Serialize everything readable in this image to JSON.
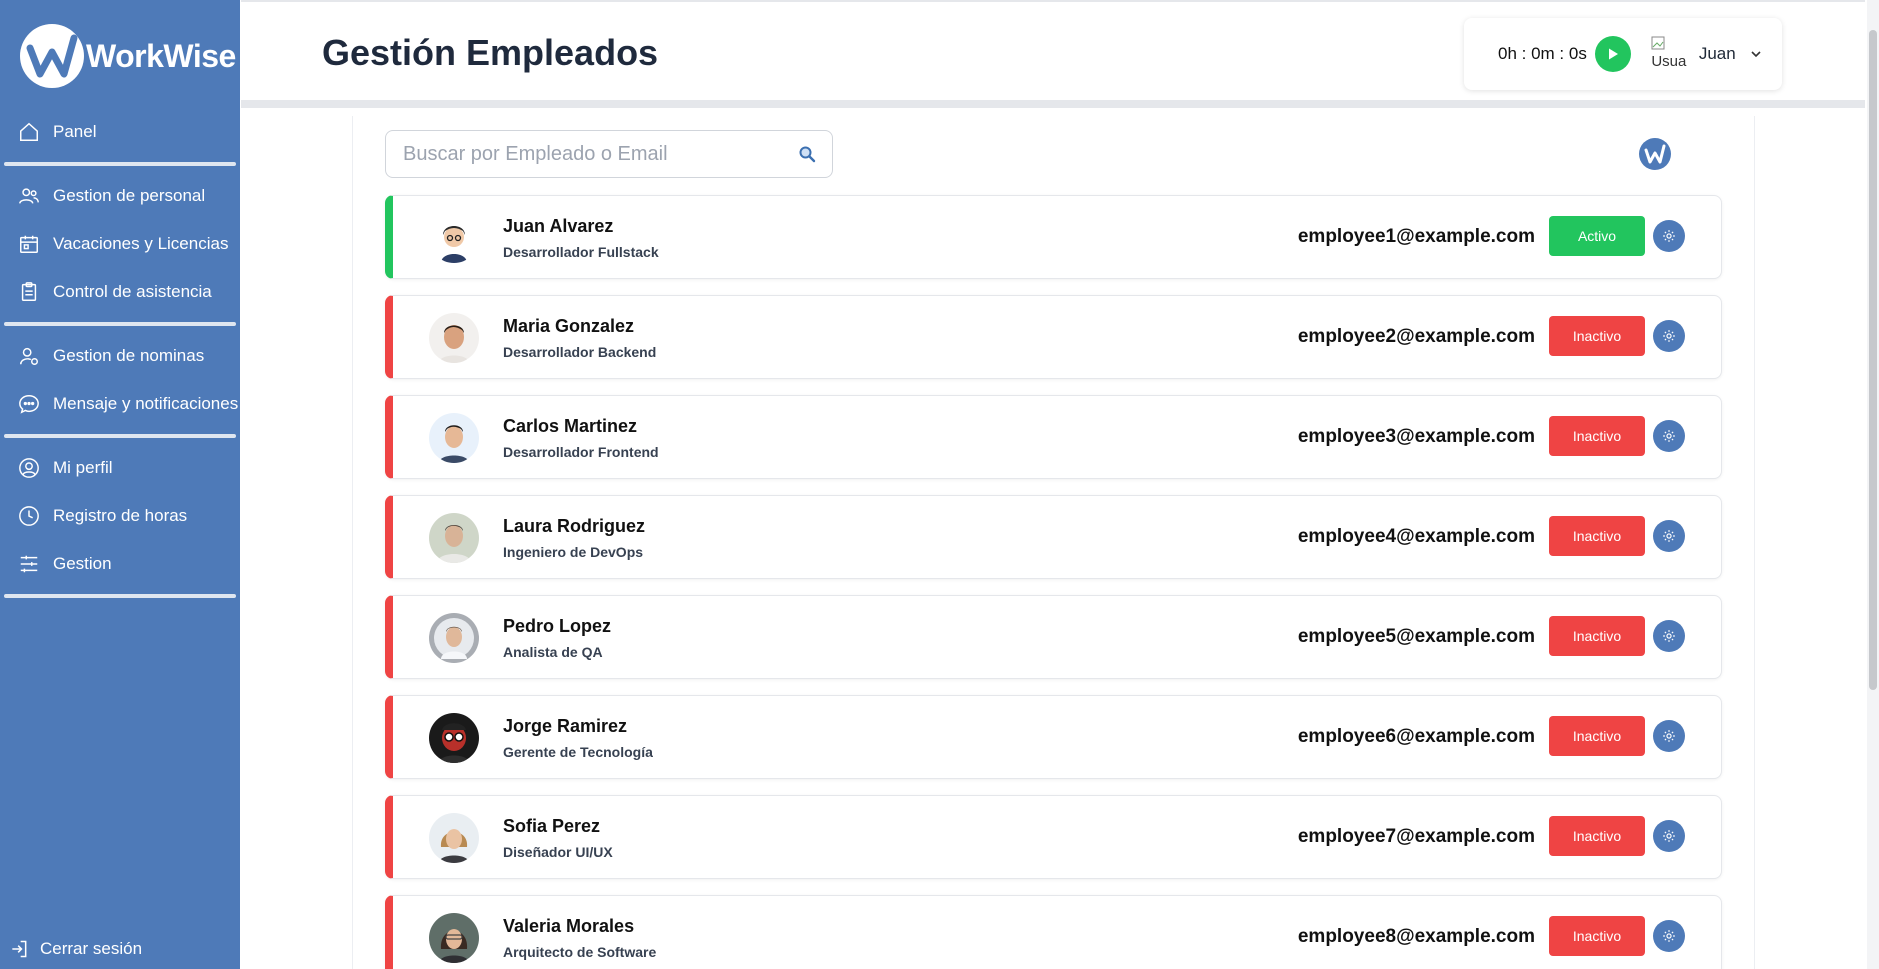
{
  "app": {
    "brand": "WorkWise"
  },
  "sidebar": {
    "items": [
      {
        "label": "Panel",
        "icon": "home-icon"
      },
      {
        "label": "Gestion de personal",
        "icon": "users-icon"
      },
      {
        "label": "Vacaciones y Licencias",
        "icon": "calendar-icon"
      },
      {
        "label": "Control de asistencia",
        "icon": "clipboard-icon"
      },
      {
        "label": "Gestion de nominas",
        "icon": "user-gear-icon"
      },
      {
        "label": "Mensaje y notificaciones",
        "icon": "chat-icon"
      },
      {
        "label": "Mi perfil",
        "icon": "user-circle-icon"
      },
      {
        "label": "Registro de horas",
        "icon": "clock-icon"
      },
      {
        "label": "Gestion",
        "icon": "sliders-icon"
      }
    ],
    "logout": "Cerrar sesión"
  },
  "header": {
    "title": "Gestión Empleados",
    "timer": "0h : 0m : 0s",
    "avatar_alt": "Usua",
    "user_name": "Juan"
  },
  "search": {
    "placeholder": "Buscar por Empleado o Email"
  },
  "employees": [
    {
      "name": "Juan Alvarez",
      "role": "Desarrollador Fullstack",
      "email": "employee1@example.com",
      "status": "Activo"
    },
    {
      "name": "Maria Gonzalez",
      "role": "Desarrollador Backend",
      "email": "employee2@example.com",
      "status": "Inactivo"
    },
    {
      "name": "Carlos Martinez",
      "role": "Desarrollador Frontend",
      "email": "employee3@example.com",
      "status": "Inactivo"
    },
    {
      "name": "Laura Rodriguez",
      "role": "Ingeniero de DevOps",
      "email": "employee4@example.com",
      "status": "Inactivo"
    },
    {
      "name": "Pedro Lopez",
      "role": "Analista de QA",
      "email": "employee5@example.com",
      "status": "Inactivo"
    },
    {
      "name": "Jorge Ramirez",
      "role": "Gerente de Tecnología",
      "email": "employee6@example.com",
      "status": "Inactivo"
    },
    {
      "name": "Sofia Perez",
      "role": "Diseñador UI/UX",
      "email": "employee7@example.com",
      "status": "Inactivo"
    },
    {
      "name": "Valeria Morales",
      "role": "Arquitecto de Software",
      "email": "employee8@example.com",
      "status": "Inactivo"
    }
  ],
  "colors": {
    "sidebar": "#4e7ab8",
    "active": "#22c55e",
    "inactive": "#ef4444",
    "accent": "#4e7ab8"
  }
}
